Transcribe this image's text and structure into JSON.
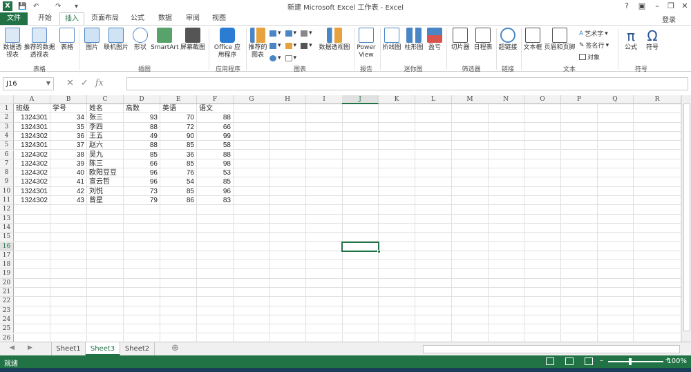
{
  "window": {
    "title": "新建 Microsoft Excel 工作表 - Excel",
    "help": "?",
    "login": "登录"
  },
  "tabs": [
    "文件",
    "开始",
    "插入",
    "页面布局",
    "公式",
    "数据",
    "审阅",
    "视图"
  ],
  "ribbon": {
    "buttons": {
      "pivot": "数据透视表",
      "rec_pivot": "推荐的数据透视表",
      "table": "表格",
      "picture": "图片",
      "online_picture": "联机图片",
      "shapes": "形状",
      "smartart": "SmartArt",
      "screenshot": "屏幕截图",
      "office_apps": "Office 应用程序",
      "rec_charts": "推荐的图表",
      "pivot_chart": "数据透视图",
      "power_view": "Power View",
      "spark_line": "折线图",
      "spark_column": "柱形图",
      "spark_winloss": "盈亏",
      "slicer": "切片器",
      "timeline": "日程表",
      "hyperlink": "超链接",
      "textbox": "文本框",
      "header_footer": "页眉和页脚",
      "wordart": "艺术字",
      "signature": "签名行",
      "object": "对象",
      "equation": "公式",
      "symbol": "符号"
    },
    "groups": {
      "tables": "表格",
      "illustrations": "插图",
      "apps": "应用程序",
      "charts": "图表",
      "reports": "报告",
      "sparklines": "迷你图",
      "filters": "筛选器",
      "links": "链接",
      "text": "文本",
      "symbols": "符号"
    }
  },
  "formula_bar": {
    "name_box": "J16",
    "fx": "fx",
    "value": ""
  },
  "columns": [
    "A",
    "B",
    "C",
    "D",
    "E",
    "F",
    "G",
    "H",
    "I",
    "J",
    "K",
    "L",
    "M",
    "N",
    "O",
    "P",
    "Q",
    "R"
  ],
  "selected_cell": {
    "col": "J",
    "row": "16"
  },
  "rows": [
    [
      "班级",
      "学号",
      "姓名",
      "高数",
      "英语",
      "语文"
    ],
    [
      "1324301",
      "34",
      "张三",
      "93",
      "70",
      "88"
    ],
    [
      "1324301",
      "35",
      "李四",
      "88",
      "72",
      "66"
    ],
    [
      "1324302",
      "36",
      "王五",
      "49",
      "90",
      "99"
    ],
    [
      "1324301",
      "37",
      "赵六",
      "88",
      "85",
      "58"
    ],
    [
      "1324302",
      "38",
      "吴九",
      "85",
      "36",
      "88"
    ],
    [
      "1324302",
      "39",
      "陈三",
      "66",
      "85",
      "98"
    ],
    [
      "1324302",
      "40",
      "欧阳豆豆",
      "96",
      "76",
      "53"
    ],
    [
      "1324302",
      "41",
      "宣云哲",
      "96",
      "54",
      "85"
    ],
    [
      "1324301",
      "42",
      "刘悦",
      "73",
      "85",
      "96"
    ],
    [
      "1324302",
      "43",
      "曾星",
      "79",
      "86",
      "83"
    ]
  ],
  "row_numbers": [
    "1",
    "2",
    "3",
    "4",
    "5",
    "6",
    "7",
    "8",
    "9",
    "10",
    "11",
    "12",
    "13",
    "14",
    "15",
    "16",
    "17",
    "18",
    "19",
    "20",
    "21",
    "22",
    "23",
    "24",
    "25",
    "26"
  ],
  "sheets": [
    "Sheet1",
    "Sheet3",
    "Sheet2"
  ],
  "active_sheet": "Sheet3",
  "status": {
    "ready": "就绪",
    "zoom": "100%"
  },
  "colors": {
    "excel_green": "#217346"
  }
}
